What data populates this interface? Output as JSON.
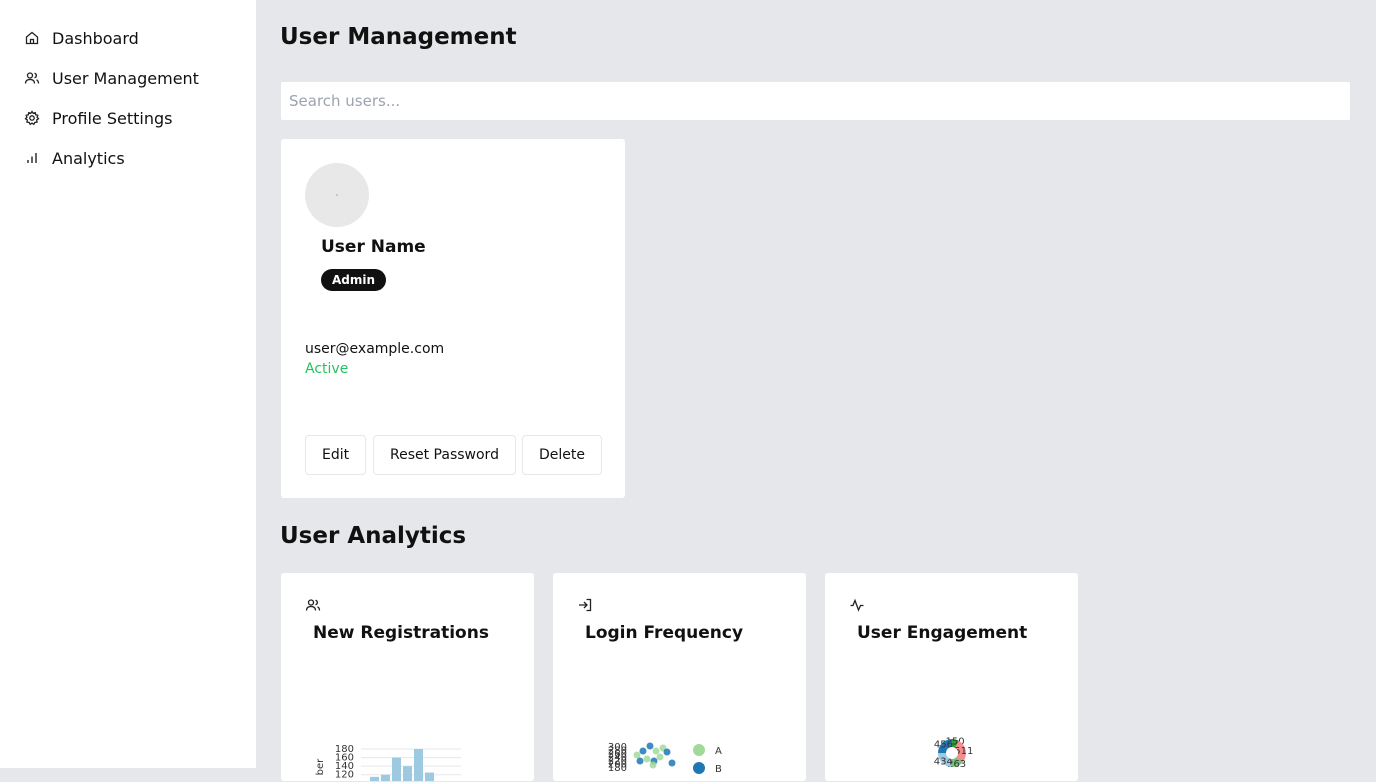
{
  "sidebar": {
    "items": [
      {
        "label": "Dashboard",
        "icon": "home-icon"
      },
      {
        "label": "User Management",
        "icon": "users-icon"
      },
      {
        "label": "Profile Settings",
        "icon": "gear-icon"
      },
      {
        "label": "Analytics",
        "icon": "bar-chart-icon"
      }
    ]
  },
  "main": {
    "title": "User Management",
    "search": {
      "placeholder": "Search users...",
      "value": ""
    },
    "user_card": {
      "name": "User Name",
      "role": "Admin",
      "email": "user@example.com",
      "status": "Active",
      "status_color": "#22c55e",
      "actions": {
        "edit": "Edit",
        "reset": "Reset Password",
        "delete": "Delete"
      }
    },
    "analytics_title": "User Analytics",
    "cards": [
      {
        "title": "New Registrations",
        "icon": "users-icon"
      },
      {
        "title": "Login Frequency",
        "icon": "login-icon"
      },
      {
        "title": "User Engagement",
        "icon": "activity-icon"
      }
    ]
  },
  "chart_data": [
    {
      "type": "bar",
      "ylabel": "ber",
      "y_ticks": [
        "180",
        "160",
        "140",
        "120"
      ],
      "values": [
        115,
        120,
        160,
        140,
        180,
        125
      ],
      "ylim": [
        110,
        180
      ],
      "color": "#9ecae1"
    },
    {
      "type": "scatter",
      "y_ticks": [
        "300",
        "280",
        "260",
        "240",
        "220",
        "200",
        "180"
      ],
      "legend": [
        "A",
        "B"
      ],
      "series_colors": [
        "#a1d99b",
        "#1f77b4"
      ],
      "ylim": [
        170,
        300
      ]
    },
    {
      "type": "pie",
      "labels": [
        "150",
        "511",
        "263",
        "434",
        "456"
      ],
      "values": [
        150,
        511,
        263,
        434,
        456
      ],
      "colors": [
        "#2ca02c",
        "#f28e8e",
        "#74c476",
        "#9ecae1",
        "#1f77b4"
      ]
    }
  ]
}
